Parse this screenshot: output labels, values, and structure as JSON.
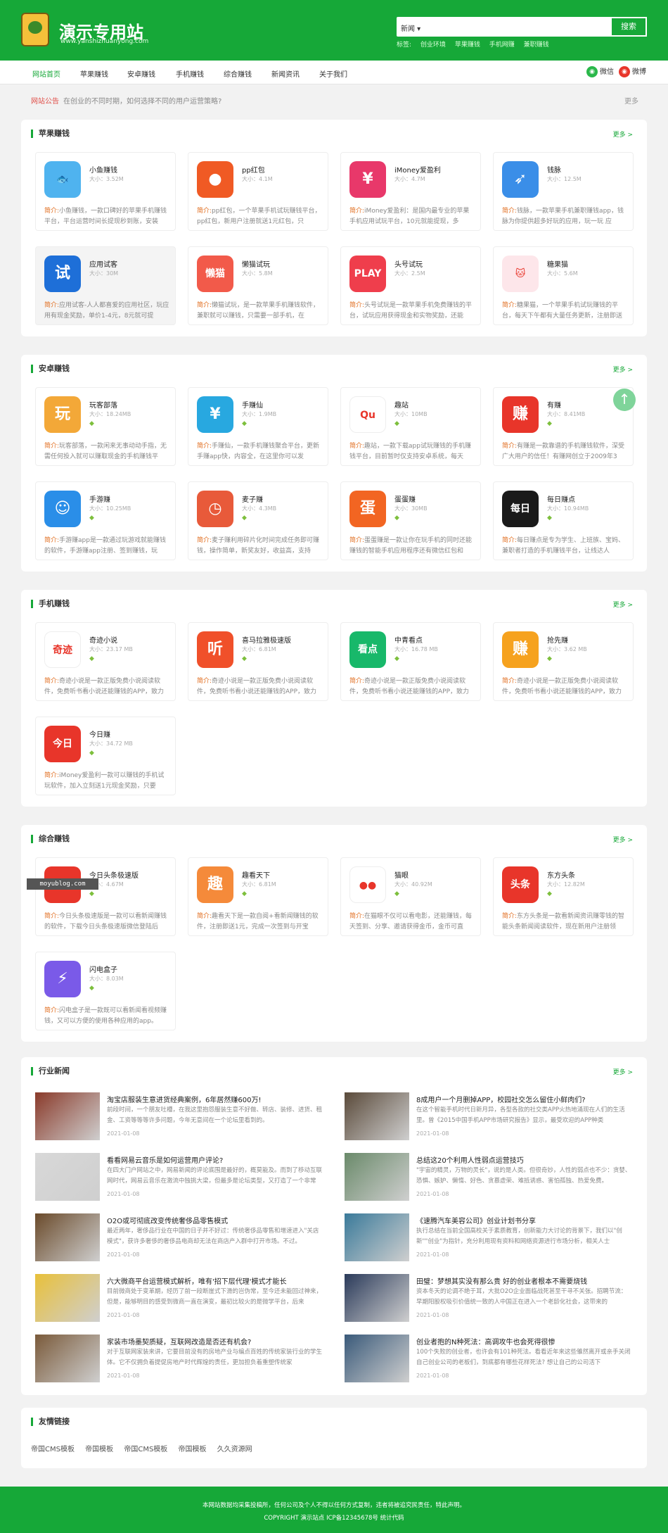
{
  "site": {
    "title": "演示专用站",
    "url": "www.yanshizhuanyong.com",
    "logo_icon": "bag-logo-icon"
  },
  "search": {
    "select": "新闻",
    "placeholder": "",
    "button": "搜索",
    "tags_label": "标签:",
    "tags": [
      "创业环境",
      "苹果赚钱",
      "手机网赚",
      "兼职赚钱"
    ]
  },
  "nav": {
    "items": [
      "网站首页",
      "苹果赚钱",
      "安卓赚钱",
      "手机赚钱",
      "综合赚钱",
      "新闻资讯",
      "关于我们"
    ],
    "wechat": "微信",
    "weibo": "微博"
  },
  "notice": {
    "label": "网站公告",
    "text": "在创业的不同时期，如何选择不同的用户运营策略?",
    "more": "更多"
  },
  "desc_label": "简介:",
  "sections": [
    {
      "title": "苹果赚钱",
      "more": "更多 >",
      "apps": [
        {
          "name": "小鱼赚钱",
          "size": "大小：3.52M",
          "desc": "小鱼赚钱，一款口碑好的苹果手机赚钱平台，平台运营时间长提现秒到账，安装",
          "color": "#4fb3ef",
          "glyph": "🐟",
          "platforms": "a"
        },
        {
          "name": "pp红包",
          "size": "大小：4.1M",
          "desc": "pp红包，一个苹果手机试玩赚钱平台，pp红包，新用户注册就送1元红包，只",
          "color": "#f05a24",
          "glyph": "●",
          "platforms": "a"
        },
        {
          "name": "iMoney爱盈利",
          "size": "大小：4.7M",
          "desc": "iMoney爱盈利：是国内最专业的苹果手机应用试玩平台，10元就能提现，多",
          "color": "#e8386a",
          "glyph": "¥",
          "platforms": "a"
        },
        {
          "name": "钱脉",
          "size": "大小：12.5M",
          "desc": "钱脉，一款苹果手机兼职赚钱app，钱脉为你提供超多好玩的应用，玩一玩 应",
          "color": "#3a8ee8",
          "glyph": "➶",
          "platforms": "a"
        },
        {
          "name": "应用试客",
          "size": "大小：30M",
          "desc": "应用试客-人人都喜爱的应用社区，玩应用有现金奖励，单价1-4元，8元就可提",
          "color": "#1e6fd8",
          "glyph": "试",
          "platforms": "a"
        },
        {
          "name": "懒猫试玩",
          "size": "大小：5.8M",
          "desc": "懒猫试玩，是一款苹果手机赚钱软件，兼职就可以赚钱，只需要一部手机，在",
          "color": "#f25a4a",
          "glyph": "懒猫",
          "platforms": "a"
        },
        {
          "name": "头号试玩",
          "size": "大小：2.5M",
          "desc": "头号试玩是一款苹果手机免费赚钱的平台，试玩应用获得现金和实物奖励，还能",
          "color": "#ef3e4c",
          "glyph": "PLAY",
          "platforms": "a"
        },
        {
          "name": "糖果猫",
          "size": "大小：5.6M",
          "desc": "糖果猫，一个苹果手机试玩赚钱的平台，每天下午都有大量任务更新，注册即送",
          "color": "#fde6ea",
          "glyph": "🐱",
          "platforms": "a"
        }
      ]
    },
    {
      "title": "安卓赚钱",
      "more": "更多 >",
      "apps": [
        {
          "name": "玩客部落",
          "size": "大小：18.24MB",
          "desc": "玩客部落，一款闲来无事动动手指，无需任何投入就可以赚取现金的手机赚钱平",
          "color": "#f3a838",
          "glyph": "玩",
          "platforms": "ag"
        },
        {
          "name": "手赚仙",
          "size": "大小：1.9MB",
          "desc": "手赚仙，一款手机赚钱聚合平台，更新手赚app快，内容全，在这里你可以发",
          "color": "#28a8e0",
          "glyph": "¥",
          "platforms": "g"
        },
        {
          "name": "趣站",
          "size": "大小：10MB",
          "desc": "趣站，一款下载app试玩赚钱的手机赚钱平台，目前暂时仅支持安卓系统，每天",
          "color": "#ffffff",
          "glyph": "Qu",
          "platforms": "ag"
        },
        {
          "name": "有赚",
          "size": "大小：8.41MB",
          "desc": "有赚是一款靠谱的手机赚钱软件，深受广大用户的信任！有赚网创立于2009年3",
          "color": "#e8352a",
          "glyph": "赚",
          "platforms": "g"
        },
        {
          "name": "手游赚",
          "size": "大小：10.25MB",
          "desc": "手游赚app是一款通过玩游戏就能赚钱的软件，手游赚app注册、签到赚钱，玩",
          "color": "#2a8ee8",
          "glyph": "☺",
          "platforms": "g"
        },
        {
          "name": "麦子赚",
          "size": "大小：4.3MB",
          "desc": "麦子赚利用碎片化时间完成任务即可赚钱，操作简单，新奖友好，收益高，支持",
          "color": "#e85a3a",
          "glyph": "◷",
          "platforms": "g"
        },
        {
          "name": "蛋蛋赚",
          "size": "大小：30MB",
          "desc": "蛋蛋赚是一款让你在玩手机的同时还能赚钱的智能手机应用程序还有微信红包和",
          "color": "#f26522",
          "glyph": "蛋",
          "platforms": "ag"
        },
        {
          "name": "每日赚点",
          "size": "大小：10.94MB",
          "desc": "每日赚点是专为学生、上班族、宝妈、兼职者打造的手机赚钱平台，让线达人",
          "color": "#1a1a1a",
          "glyph": "每日",
          "platforms": "g"
        }
      ]
    },
    {
      "title": "手机赚钱",
      "more": "更多 >",
      "apps": [
        {
          "name": "奇迹小说",
          "size": "大小：23.17 MB",
          "desc": "奇迹小说是一款正版免费小说阅读软件，免费听书看小说还能赚钱的APP，致力",
          "color": "#ffffff",
          "glyph": "奇迹",
          "platforms": "ag"
        },
        {
          "name": "喜马拉雅极速版",
          "size": "大小：6.81M",
          "desc": "奇迹小说是一款正版免费小说阅读软件，免费听书看小说还能赚钱的APP，致力",
          "color": "#f0502a",
          "glyph": "听",
          "platforms": "ag"
        },
        {
          "name": "中青看点",
          "size": "大小：16.78 MB",
          "desc": "奇迹小说是一款正版免费小说阅读软件，免费听书看小说还能赚钱的APP，致力",
          "color": "#18b86a",
          "glyph": "看点",
          "platforms": "ag"
        },
        {
          "name": "抢先赚",
          "size": "大小：3.62 MB",
          "desc": "奇迹小说是一款正版免费小说阅读软件，免费听书看小说还能赚钱的APP，致力",
          "color": "#f6a21e",
          "glyph": "赚",
          "platforms": "ag"
        },
        {
          "name": "今日赚",
          "size": "大小：34.72 MB",
          "desc": "iMoney爱盈利一款可以赚钱的手机试玩软件，加入立刻送1元现金奖励，只要",
          "color": "#e8352a",
          "glyph": "今日",
          "platforms": "ag"
        }
      ]
    },
    {
      "title": "综合赚钱",
      "more": "更多 >",
      "apps": [
        {
          "name": "今日头条极速版",
          "size": "大小：4.67M",
          "desc": "今日头条极速版是一款可以看新闻赚钱的软件，下载今日头条极速版微信登陆后",
          "color": "#e8352a",
          "glyph": "头条",
          "platforms": "ag"
        },
        {
          "name": "趣看天下",
          "size": "大小：6.81M",
          "desc": "趣看天下是一款自阅+看新闻赚钱的软件，注册即送1元，完成一次签到与开宝",
          "color": "#f58a3a",
          "glyph": "趣",
          "platforms": "ag"
        },
        {
          "name": "猫眼",
          "size": "大小：40.92M",
          "desc": "在猫眼不仅可以看电影，还能赚钱，每天签到、分享、邀请获得金币，金币可直",
          "color": "#ffffff",
          "glyph": "●●",
          "platforms": "ag"
        },
        {
          "name": "东方头条",
          "size": "大小：12.82M",
          "desc": "东方头条是一款看新闻资讯赚零钱的智能头条新闻阅读软件，现在新用户注册领",
          "color": "#e8352a",
          "glyph": "头条",
          "platforms": "ag"
        },
        {
          "name": "闪电盒子",
          "size": "大小：8.03M",
          "desc": "闪电盒子是一款既可以看新闻看视频赚钱，又可以方便的使用各种应用的app。",
          "color": "#7a5ae8",
          "glyph": "⚡",
          "platforms": "ag"
        }
      ]
    }
  ],
  "news": {
    "title": "行业新闻",
    "more": "更多 >",
    "items": [
      {
        "title": "淘宝店服装生意进货经典案例，6年居然赚600万!",
        "desc": "前段时间，一个朋友吐槽，在我这里抱怨服装生意不好做、转店、装修、进货、租金、工资等等等许多问题，今年无意间在一个论坛里看到的。",
        "date": "2021-01-08",
        "color": "#8a3a2a"
      },
      {
        "title": "8成用户一个月删掉APP，校园社交怎么留住小鲜肉们?",
        "desc": "在这个智能手机时代日新月异，各型各款的社交类APP火热地涌现在人们的生活里。曾《2015中国手机APP市场研究报告》显示，最受欢迎的APP种类",
        "date": "2021-01-08",
        "color": "#5a4a3a"
      },
      {
        "title": "看看网易云音乐是如何运营用户评论?",
        "desc": "在四大门户网站之中，网易新闻的评论底围是最好的，概莫能及。而到了移动互联网时代，网易云音乐在激流中独挑大梁，但最多是论坛类型，又打造了一个非常",
        "date": "2021-01-08",
        "color": "#d8d8d8"
      },
      {
        "title": "总结这20个利用人性弱点运营技巧",
        "desc": "\"宇宙的精灵，万物的灵长\"，说的是人类。但很奇妙，人性的弱点也不少：贪婪、恐惧、嫉妒、懒惰、好色、贪慕虚荣、难抵诱惑、害怕孤独、热爱免费。",
        "date": "2021-01-08",
        "color": "#6a8a6a"
      },
      {
        "title": "O2O或可彻底改变传统奢侈品零售模式",
        "desc": "最近两年，奢侈品行业在中国的日子并不好过：传统奢侈品零售和增速进入\"关店模式\"，获许多奢侈的奢侈品电商却无法在商店产入群中打开市场。不过。",
        "date": "2021-01-08",
        "color": "#6a4a2a"
      },
      {
        "title": "《速腾汽车美容公司》创业计划书分享",
        "desc": "执行总结在当前全国高校关于素质教育，创新能力大讨论的背景下，我们以\"创新\"\"创业\"为指针，充分利用现有资料和网络资源进行市场分析，相关人士",
        "date": "2021-01-08",
        "color": "#3a7a9a"
      },
      {
        "title": "六大微商平台运营模式解析，唯有'招下层代理'模式才能长",
        "desc": "目前微商处于变革期，经历了前一段断崖式下滑的岂伪常，至今还未能回过神来，但是，能够明目的感受到微商一直在演变，最初比较火的是微学平台，后来",
        "date": "2021-01-08",
        "color": "#e8c03a"
      },
      {
        "title": "田璧：梦想其实没有那么贵 好的创业者根本不需要烧钱",
        "desc": "资本冬天的论调不绝于耳，大批O2O企业面临战死甚至干寻不关张。招聘节流：早期阳股权吸引价值统一致的人中国正在进入一个老龄化社会，这带来的",
        "date": "2021-01-08",
        "color": "#2a3a5a"
      },
      {
        "title": "家装市场墨契质疑，互联网改造是否还有机会?",
        "desc": "对于互联网家装来讲，它要目前没有的房地产业与编点百姓的传统家装行业的学生体。它不仅拥负着提促房地产时代辉煌的责任，更加担负着重塑传统家",
        "date": "2021-01-08",
        "color": "#7a5a3a"
      },
      {
        "title": "创业者抱的N种死法：高调攻牛也会死得很惨",
        "desc": "100个失败的创业者，也许会有101种死法。看看近年来这些雏然离开或亲手关闭自己创业公司的老板们，到底都有哪些花样死法? 想让自己的公司活下",
        "date": "2021-01-08",
        "color": "#3a5a7a"
      }
    ]
  },
  "links": {
    "title": "友情链接",
    "items": [
      "帝国CMS模板",
      "帝国模板",
      "帝国CMS模板",
      "帝国模板",
      "久久资源网"
    ]
  },
  "footer": {
    "line1": "本网站数据均采集投稿所，任何公司及个人不得以任何方式复制，违者将被追究民责任，特此声明。",
    "line2": "COPYRIGHT 演示站点 ICP备12345678号 统计代码"
  },
  "watermark": "moyublog.com",
  "back_to_top": "↑",
  "colors": {
    "primary": "#16a838",
    "accent": "#e06b1c"
  }
}
